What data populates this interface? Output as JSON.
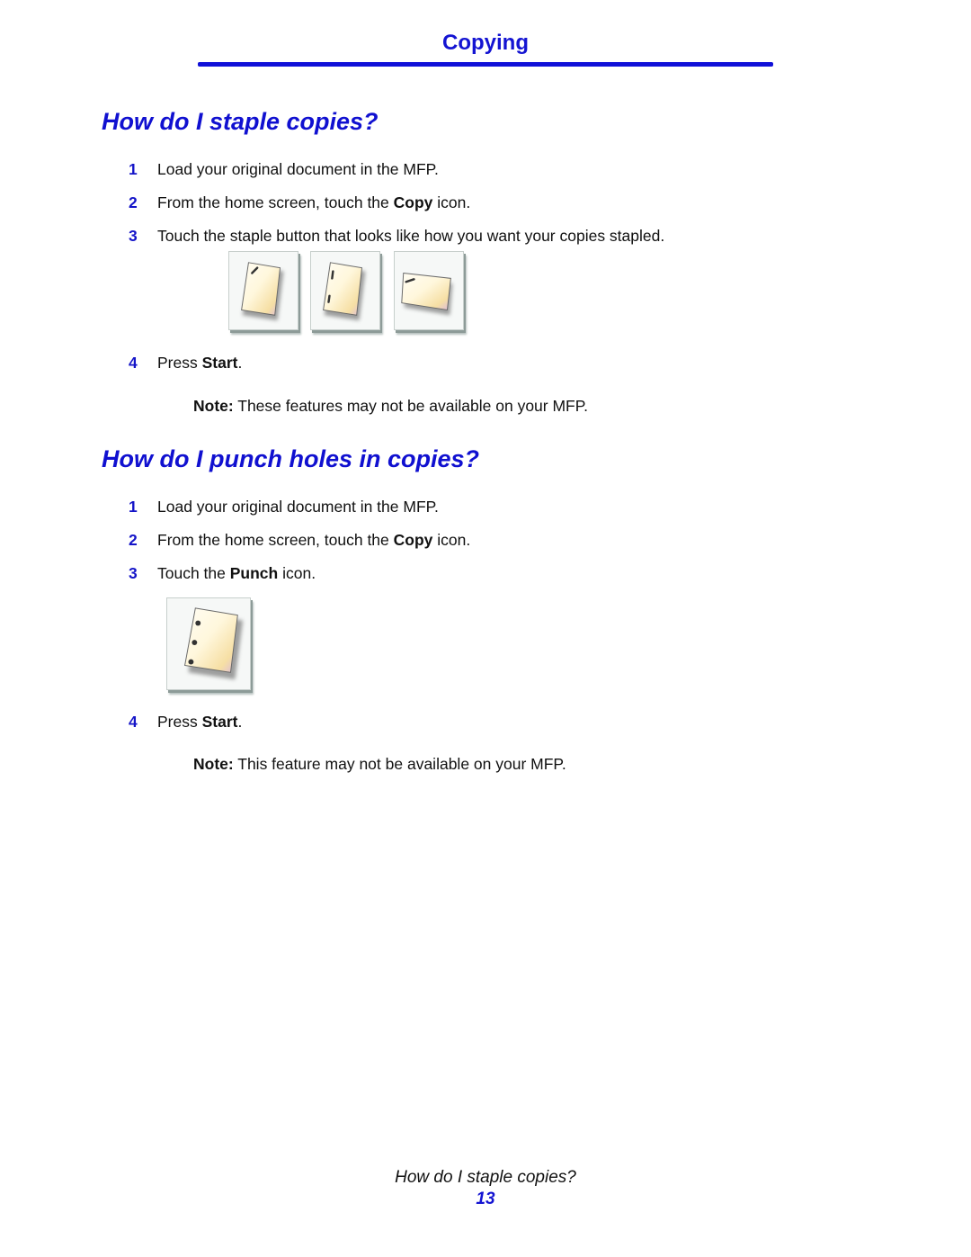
{
  "header": {
    "chapter": "Copying",
    "accent_color": "#1414d2"
  },
  "sections": [
    {
      "title": "How do I staple copies?",
      "steps": [
        {
          "num": "1",
          "pre": "Load your original document in the MFP.",
          "bold": "",
          "post": ""
        },
        {
          "num": "2",
          "pre": "From the home screen, touch the ",
          "bold": "Copy",
          "post": " icon."
        },
        {
          "num": "3",
          "pre": "Touch the staple button that looks like how you want your copies stapled.",
          "bold": "",
          "post": ""
        },
        {
          "num": "4",
          "pre": "Press ",
          "bold": "Start",
          "post": "."
        }
      ],
      "buttons": [
        {
          "icon": "staple-single-corner-icon"
        },
        {
          "icon": "staple-dual-edge-icon"
        },
        {
          "icon": "staple-landscape-corner-icon"
        }
      ],
      "note": {
        "label": "Note:",
        "text": " These features may not be available on your MFP."
      }
    },
    {
      "title": "How do I punch holes in copies?",
      "steps": [
        {
          "num": "1",
          "pre": "Load your original document in the MFP.",
          "bold": "",
          "post": ""
        },
        {
          "num": "2",
          "pre": "From the home screen, touch the ",
          "bold": "Copy",
          "post": " icon."
        },
        {
          "num": "3",
          "pre": "Touch the ",
          "bold": "Punch",
          "post": " icon."
        },
        {
          "num": "4",
          "pre": "Press ",
          "bold": "Start",
          "post": "."
        }
      ],
      "buttons": [
        {
          "icon": "punch-holes-icon"
        }
      ],
      "note": {
        "label": "Note:",
        "text": " This feature may not be available on your MFP."
      }
    }
  ],
  "footer": {
    "title": "How do I staple copies?",
    "page": "13"
  }
}
